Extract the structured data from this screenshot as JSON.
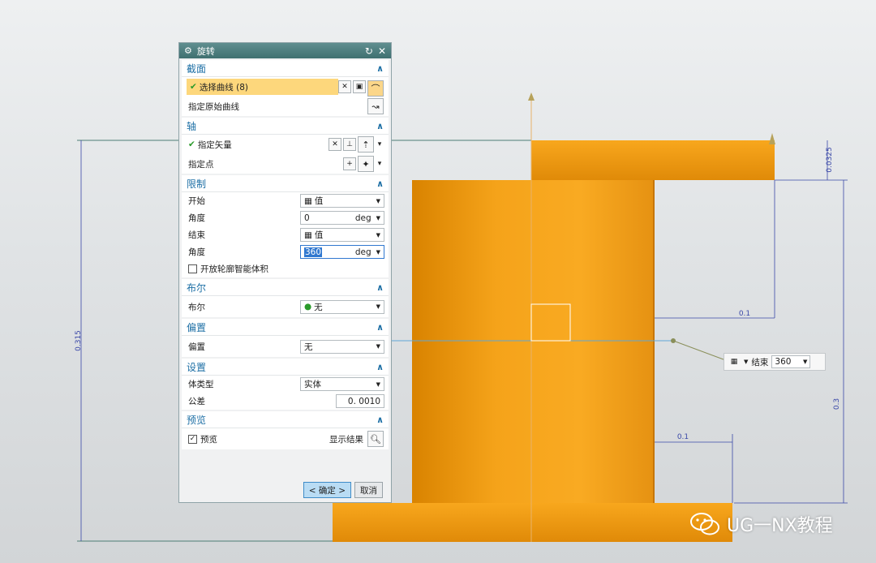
{
  "dialog": {
    "title": "旋转",
    "sections": {
      "section": {
        "header": "截面",
        "select_curve": "选择曲线 (8)",
        "specify_origin_curve": "指定原始曲线"
      },
      "axis": {
        "header": "轴",
        "specify_vector": "指定矢量",
        "specify_point": "指定点"
      },
      "limits": {
        "header": "限制",
        "start_label": "开始",
        "start_value": "值",
        "start_angle_label": "角度",
        "start_angle_value": "0",
        "start_angle_unit": "deg",
        "end_label": "结束",
        "end_value": "值",
        "end_angle_label": "角度",
        "end_angle_value": "360",
        "end_angle_unit": "deg",
        "open_profile": "开放轮廓智能体积",
        "open_profile_checked": false
      },
      "boolean": {
        "header": "布尔",
        "label": "布尔",
        "value": "无"
      },
      "offset": {
        "header": "偏置",
        "label": "偏置",
        "value": "无"
      },
      "settings": {
        "header": "设置",
        "body_type_label": "体类型",
        "body_type_value": "实体",
        "tolerance_label": "公差",
        "tolerance_value": "0. 0010"
      },
      "preview": {
        "header": "预览",
        "preview_label": "预览",
        "preview_checked": true,
        "show_result": "显示结果"
      }
    },
    "buttons": {
      "ok": "< 确定 >",
      "cancel": "取消"
    }
  },
  "float_toolbar": {
    "end_label": "结束",
    "end_value": "360"
  },
  "dimensions": {
    "top_flange_thickness": "0.0325",
    "left_total_height": "0.315",
    "right_height": "0.3",
    "upper_offset": "0.1",
    "lower_offset": "0.1"
  },
  "watermark": {
    "text": "UG一NX教程"
  },
  "colors": {
    "part_orange": "#f49d0f",
    "dialog_title": "#4a7f80",
    "section_header_text": "#1d6fa5",
    "selected_row": "#fdd77c",
    "dimension_line": "#3a48a8"
  }
}
